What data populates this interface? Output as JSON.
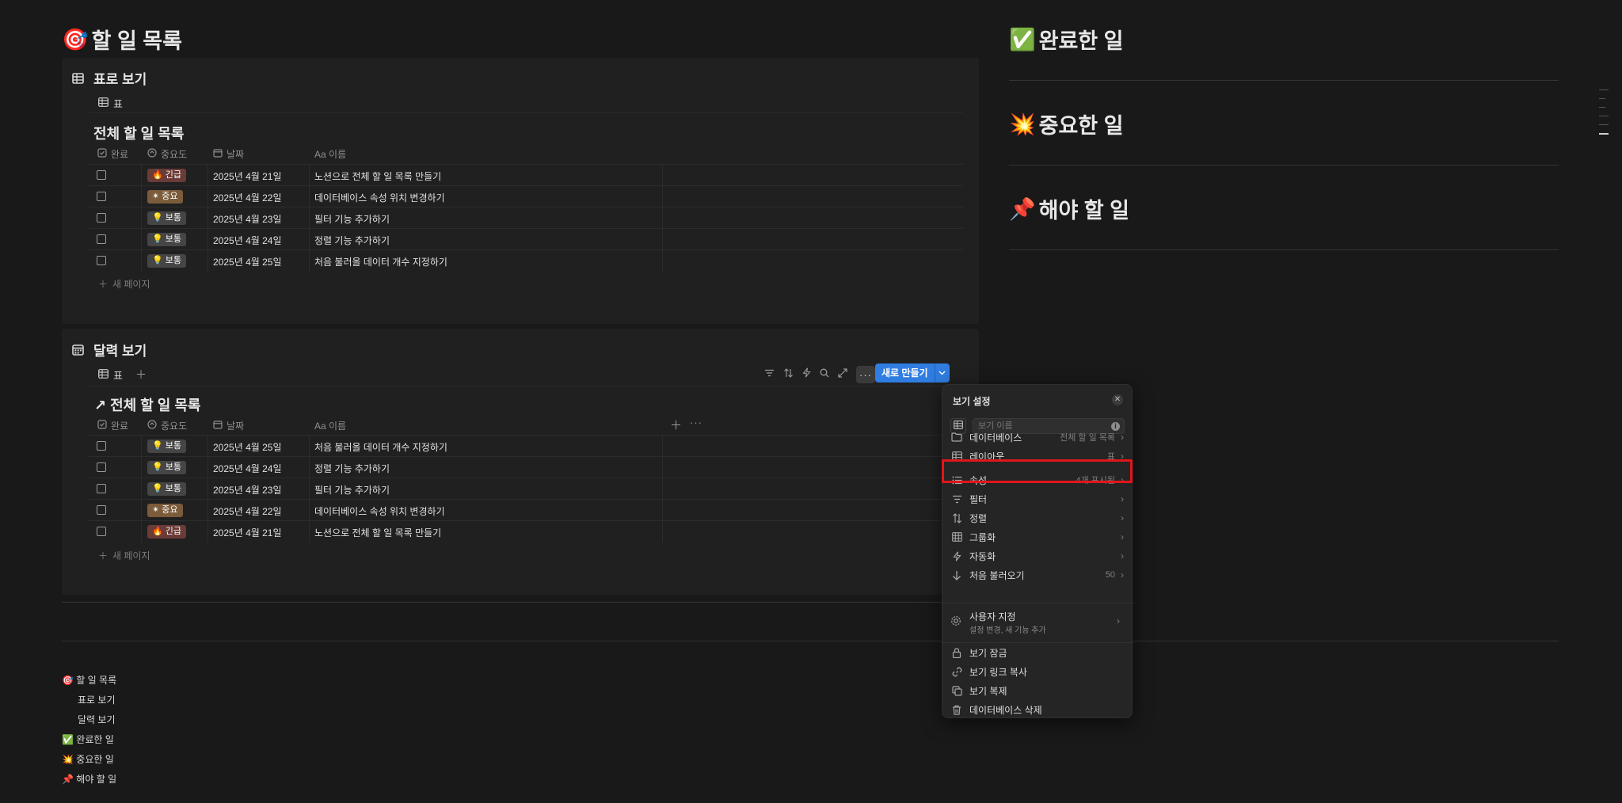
{
  "left_title": {
    "emoji": "🎯",
    "text": "할 일 목록"
  },
  "section1": {
    "title": "표로 보기",
    "tab": "표",
    "table_title": "전체 할 일 목록",
    "headers": {
      "done": "완료",
      "priority": "중요도",
      "date": "날짜",
      "name": "Aa 이름"
    },
    "rows": [
      {
        "tag": "🔥 긴급",
        "tag_type": "urgent",
        "date": "2025년 4월 21일",
        "name": "노션으로 전체 할 일 목록 만들기"
      },
      {
        "tag": "✴ 중요",
        "tag_type": "important",
        "date": "2025년 4월 22일",
        "name": "데이터베이스 속성 위치 변경하기"
      },
      {
        "tag": "💡 보통",
        "tag_type": "normal",
        "date": "2025년 4월 23일",
        "name": "필터 기능 추가하기"
      },
      {
        "tag": "💡 보통",
        "tag_type": "normal",
        "date": "2025년 4월 24일",
        "name": "정렬 기능 추가하기"
      },
      {
        "tag": "💡 보통",
        "tag_type": "normal",
        "date": "2025년 4월 25일",
        "name": "처음 불러올 데이터 개수 지정하기"
      }
    ],
    "new_page": "새 페이지"
  },
  "section2": {
    "title": "달력 보기",
    "tab": "표",
    "new_button": "새로 만들기",
    "table_title": "↗ 전체 할 일 목록",
    "headers": {
      "done": "완료",
      "priority": "중요도",
      "date": "날짜",
      "name": "Aa 이름"
    },
    "rows": [
      {
        "tag": "💡 보통",
        "tag_type": "normal",
        "date": "2025년 4월 25일",
        "name": "처음 불러올 데이터 개수 지정하기"
      },
      {
        "tag": "💡 보통",
        "tag_type": "normal",
        "date": "2025년 4월 24일",
        "name": "정렬 기능 추가하기"
      },
      {
        "tag": "💡 보통",
        "tag_type": "normal",
        "date": "2025년 4월 23일",
        "name": "필터 기능 추가하기"
      },
      {
        "tag": "✴ 중요",
        "tag_type": "important",
        "date": "2025년 4월 22일",
        "name": "데이터베이스 속성 위치 변경하기"
      },
      {
        "tag": "🔥 긴급",
        "tag_type": "urgent",
        "date": "2025년 4월 21일",
        "name": "노션으로 전체 할 일 목록 만들기"
      }
    ],
    "new_page": "새 페이지"
  },
  "right": {
    "completed": {
      "emoji": "✅",
      "text": "완료한 일"
    },
    "important": {
      "emoji": "💥",
      "text": "중요한 일"
    },
    "todo": {
      "emoji": "📌",
      "text": "해야 할 일"
    }
  },
  "toc": [
    {
      "text": "🎯 할 일 목록"
    },
    {
      "text": "표로 보기"
    },
    {
      "text": "달력 보기"
    },
    {
      "text": "✅ 완료한 일"
    },
    {
      "text": "💥 중요한 일"
    },
    {
      "text": "📌 해야 할 일"
    }
  ],
  "view_settings": {
    "title": "보기 설정",
    "name_placeholder": "보기 이름",
    "items": [
      {
        "label": "데이터베이스",
        "value": "전체 할 일 목록",
        "icon": "folder-icon"
      },
      {
        "label": "레이아웃",
        "value": "표",
        "icon": "table-icon"
      },
      {
        "label": "속성",
        "value": "4개 표시됨",
        "icon": "list-icon"
      },
      {
        "label": "필터",
        "value": "",
        "icon": "filter-icon"
      },
      {
        "label": "정렬",
        "value": "",
        "icon": "sort-icon"
      },
      {
        "label": "그룹화",
        "value": "",
        "icon": "group-icon"
      },
      {
        "label": "자동화",
        "value": "",
        "icon": "lightning-icon"
      },
      {
        "label": "처음 불러오기",
        "value": "50",
        "icon": "arrow-down-icon"
      }
    ],
    "custom": {
      "label": "사용자 지정",
      "sub": "설정 변경, 새 기능 추가"
    },
    "actions": [
      {
        "label": "보기 잠금",
        "icon": "lock-icon"
      },
      {
        "label": "보기 링크 복사",
        "icon": "link-icon"
      },
      {
        "label": "보기 복제",
        "icon": "duplicate-icon"
      },
      {
        "label": "데이터베이스 삭제",
        "icon": "trash-icon"
      }
    ]
  },
  "colors": {
    "accent": "#2f7de1",
    "highlight": "#e0161b",
    "background": "#191919"
  }
}
